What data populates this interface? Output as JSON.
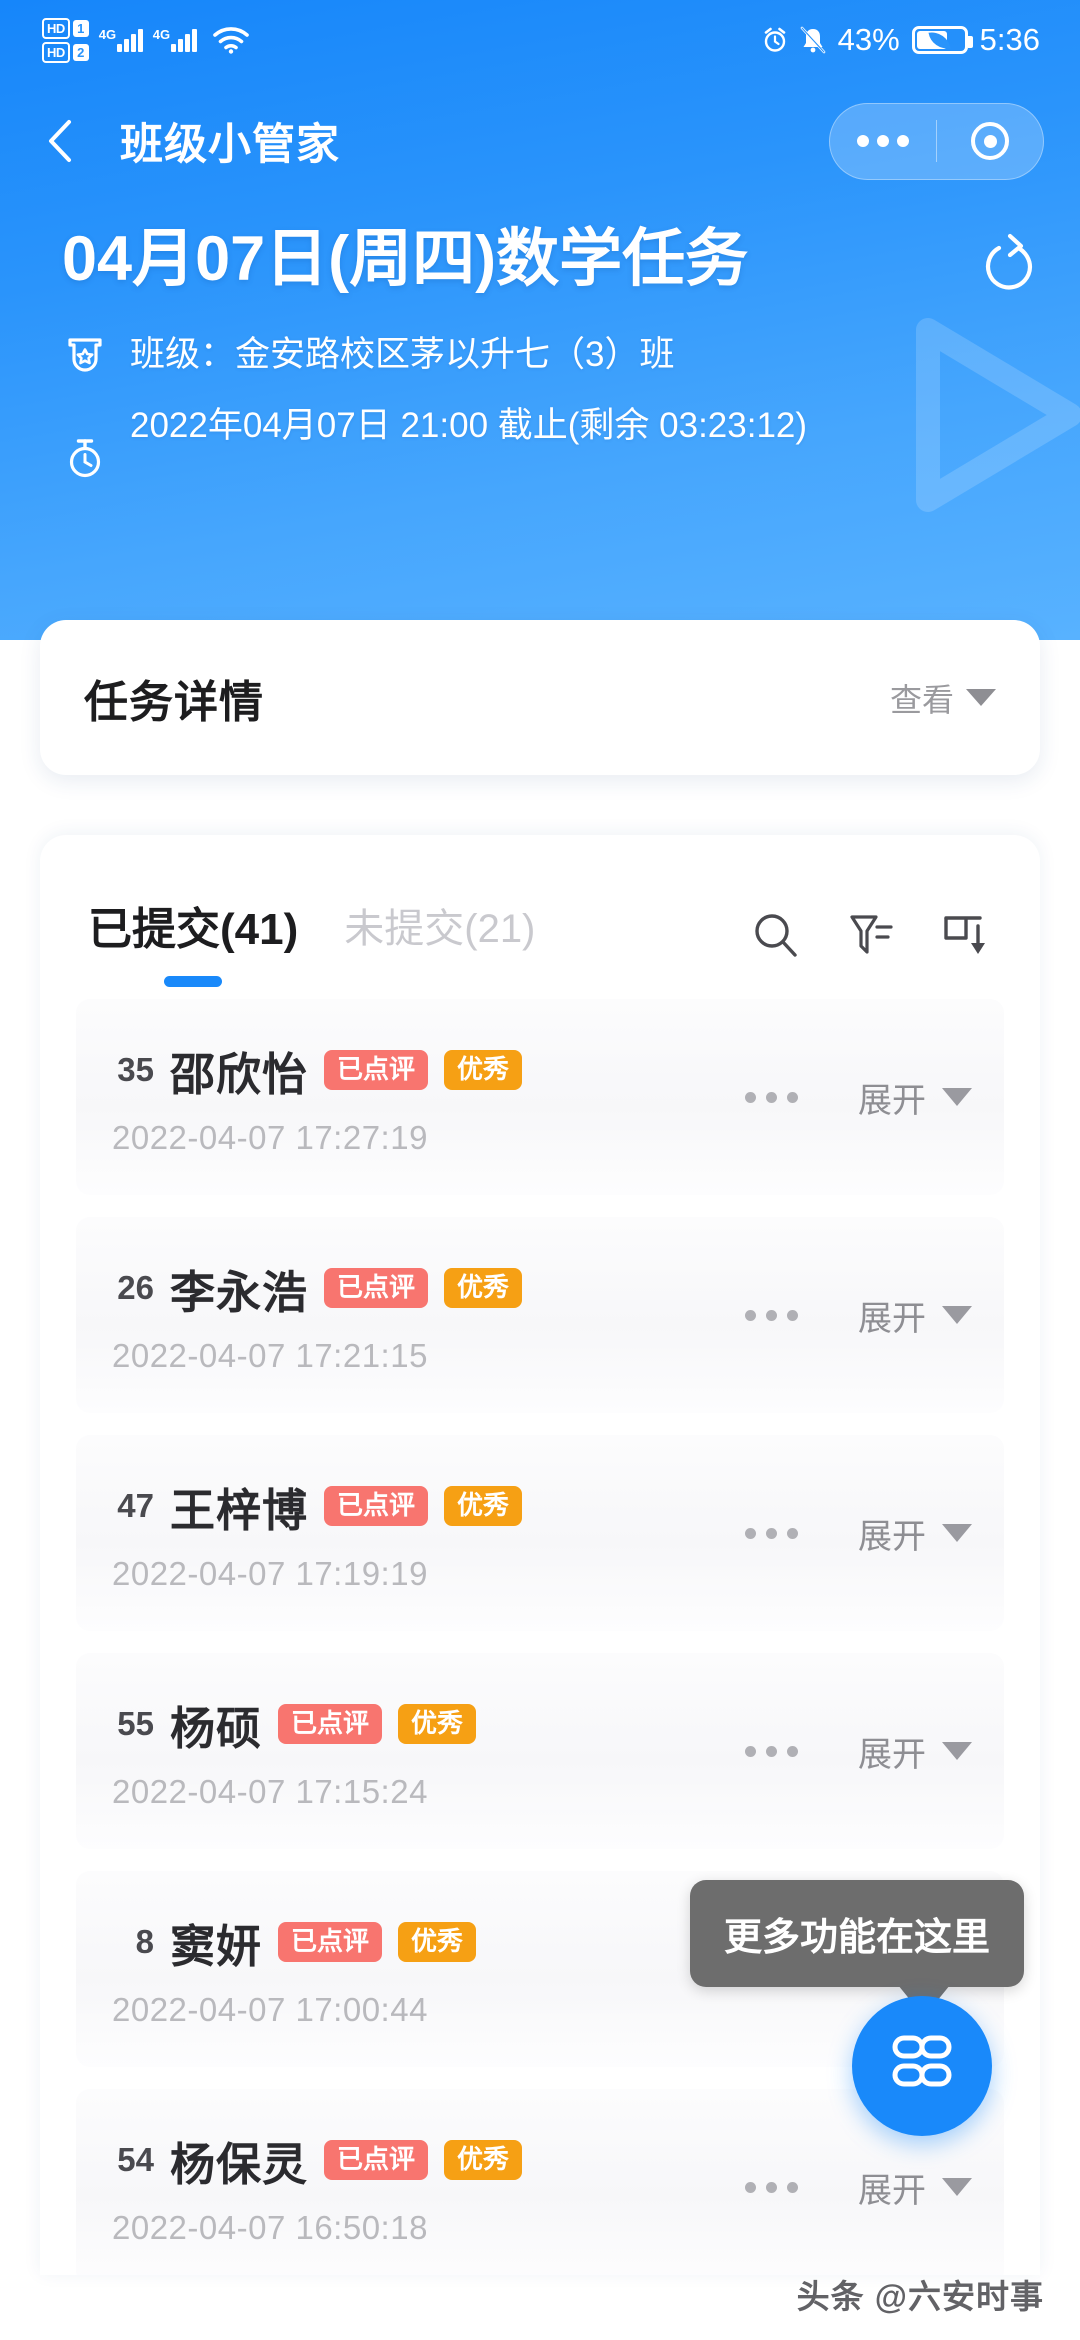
{
  "status_bar": {
    "hd1_label": "HD",
    "hd1_num": "1",
    "hd2_label": "HD",
    "hd2_num": "2",
    "net1": "4G",
    "net2": "4G",
    "battery_percent": "43%",
    "time": "5:36",
    "icons": [
      "alarm-clock-icon",
      "bell-muted-icon",
      "wifi-icon",
      "battery-saver-icon"
    ]
  },
  "nav": {
    "back_label": "back-chevron",
    "title": "班级小管家",
    "capsule": {
      "menu": "more-dots",
      "target": "capsule-target"
    }
  },
  "hero": {
    "task_title": "04月07日(周四)数学任务",
    "share_icon": "share-icon",
    "class_icon": "class-badge-icon",
    "class_label": "班级：",
    "class_name": "金安路校区茅以升七（3）班",
    "class_line": "班级：金安路校区茅以升七（3）班",
    "deadline_icon": "stopwatch-icon",
    "deadline_line": "2022年04月07日 21:00 截止(剩余 03:23:12)",
    "bg_color_start": "#1686fa",
    "bg_color_end": "#58b2ff"
  },
  "detail_card": {
    "title": "任务详情",
    "more_label": "查看"
  },
  "list": {
    "tabs": [
      {
        "label": "已提交(41)",
        "active": true,
        "name": "tab-submitted"
      },
      {
        "label": "未提交(21)",
        "active": false,
        "name": "tab-unsubmitted"
      }
    ],
    "action_icons": [
      "search-icon",
      "filter-icon",
      "sort-icon"
    ],
    "accent_color": "#1989fa",
    "row_labels": {
      "expand": "展开",
      "more": "more-dots"
    },
    "tag_colors": {
      "reviewed": "#f8756f",
      "excellent": "#f6a014"
    },
    "rows": [
      {
        "num": "35",
        "name": "邵欣怡",
        "tags": [
          "已点评",
          "优秀"
        ],
        "time": "2022-04-07 17:27:19"
      },
      {
        "num": "26",
        "name": "李永浩",
        "tags": [
          "已点评",
          "优秀"
        ],
        "time": "2022-04-07 17:21:15"
      },
      {
        "num": "47",
        "name": "王梓博",
        "tags": [
          "已点评",
          "优秀"
        ],
        "time": "2022-04-07 17:19:19"
      },
      {
        "num": "55",
        "name": "杨硕",
        "tags": [
          "已点评",
          "优秀"
        ],
        "time": "2022-04-07 17:15:24"
      },
      {
        "num": "8",
        "name": "窦妍",
        "tags": [
          "已点评",
          "优秀"
        ],
        "time": "2022-04-07 17:00:44"
      },
      {
        "num": "54",
        "name": "杨保灵",
        "tags": [
          "已点评",
          "优秀"
        ],
        "time": "2022-04-07 16:50:18"
      }
    ]
  },
  "fab": {
    "tooltip": "更多功能在这里",
    "icon": "clover-grid-icon",
    "color": "#1989fa"
  },
  "watermark": {
    "text": "头条 @六安时事"
  }
}
